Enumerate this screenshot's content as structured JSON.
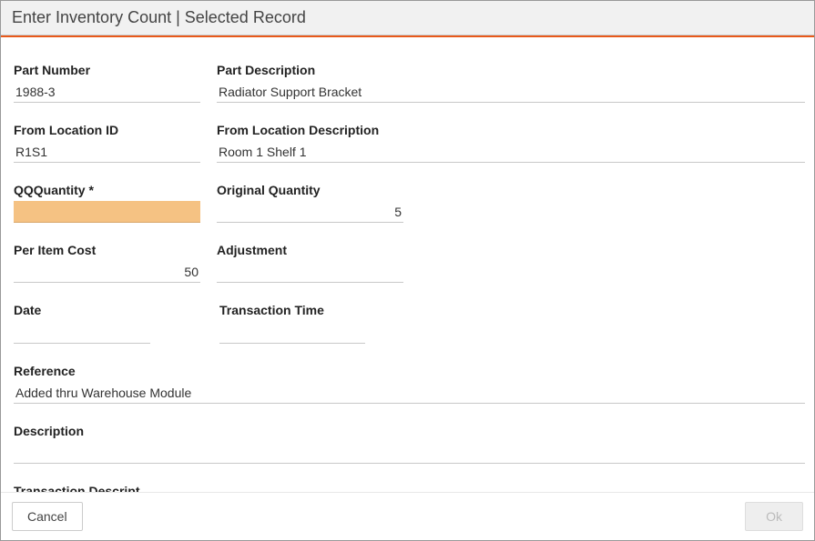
{
  "title": "Enter Inventory Count | Selected Record",
  "fields": {
    "part_number": {
      "label": "Part Number",
      "value": "1988-3"
    },
    "part_description": {
      "label": "Part Description",
      "value": "Radiator Support Bracket"
    },
    "from_location_id": {
      "label": "From Location ID",
      "value": "R1S1"
    },
    "from_location_description": {
      "label": "From Location Description",
      "value": "Room 1 Shelf 1"
    },
    "qq_quantity": {
      "label": "QQQuantity *",
      "value": ""
    },
    "original_quantity": {
      "label": "Original Quantity",
      "value": "5"
    },
    "per_item_cost": {
      "label": "Per Item Cost",
      "value": "50"
    },
    "adjustment": {
      "label": "Adjustment",
      "value": ""
    },
    "date": {
      "label": "Date",
      "value": ""
    },
    "transaction_time": {
      "label": "Transaction Time",
      "value": ""
    },
    "reference": {
      "label": "Reference",
      "value": "Added thru Warehouse Module"
    },
    "description": {
      "label": "Description",
      "value": ""
    },
    "transaction_description": {
      "label": "Transaction Descript",
      "value": ""
    }
  },
  "footer": {
    "cancel": "Cancel",
    "ok": "Ok"
  }
}
